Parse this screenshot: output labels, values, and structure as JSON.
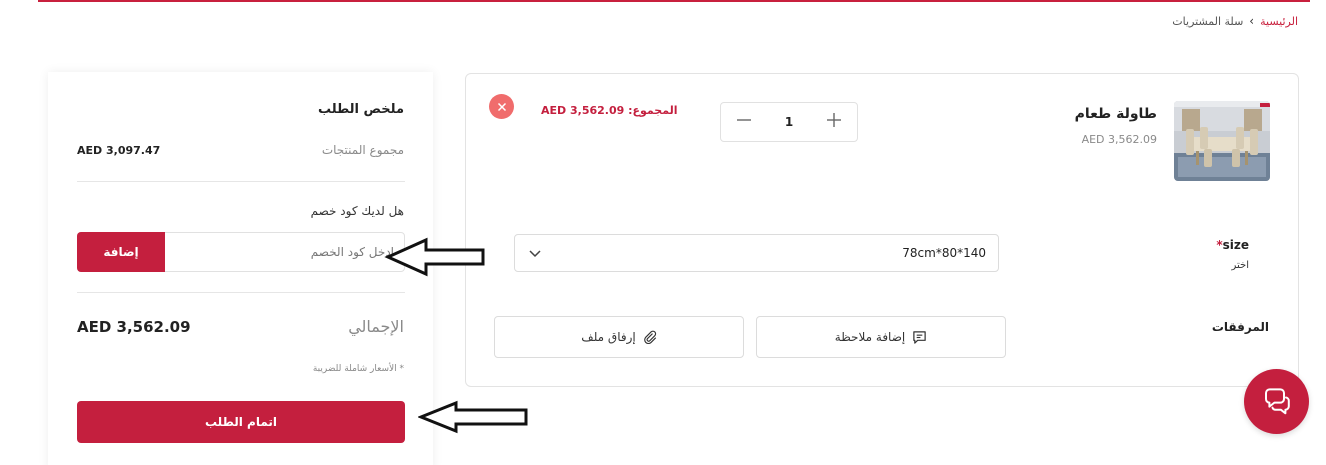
{
  "breadcrumb": {
    "home": "الرئيسية",
    "separator": "›",
    "current": "سلة المشتريات"
  },
  "summary": {
    "title": "ملخص الطلب",
    "subtotal_label": "مجموع المنتجات",
    "subtotal_value": "AED 3,097.47",
    "coupon_question": "هل لديك كود خصم",
    "coupon_placeholder": "ادخل كود الخصم",
    "coupon_button": "إضافة",
    "total_label": "الإجمالي",
    "total_value": "AED 3,562.09",
    "tax_note": "* الأسعار شاملة للضريبة",
    "checkout_button": "اتمام الطلب"
  },
  "cart_item": {
    "name": "طاولة طعام",
    "unit_price": "AED 3,562.09",
    "quantity": "1",
    "line_total": "المجموع: AED 3,562.09",
    "remove_icon": "close-icon",
    "size_label": "size",
    "size_required_mark": "*",
    "size_choose": "اختر",
    "size_value": "78cm*80*140",
    "attachments_label": "المرفقات",
    "add_note": "إضافة ملاحظة",
    "attach_file": "إرفاق ملف"
  },
  "icons": {
    "chat": "chat-icon",
    "note": "note-icon",
    "attach": "paperclip-icon",
    "dropdown": "chevron-down-icon"
  },
  "colors": {
    "accent": "#c41f3e",
    "remove": "#f06c6c"
  }
}
